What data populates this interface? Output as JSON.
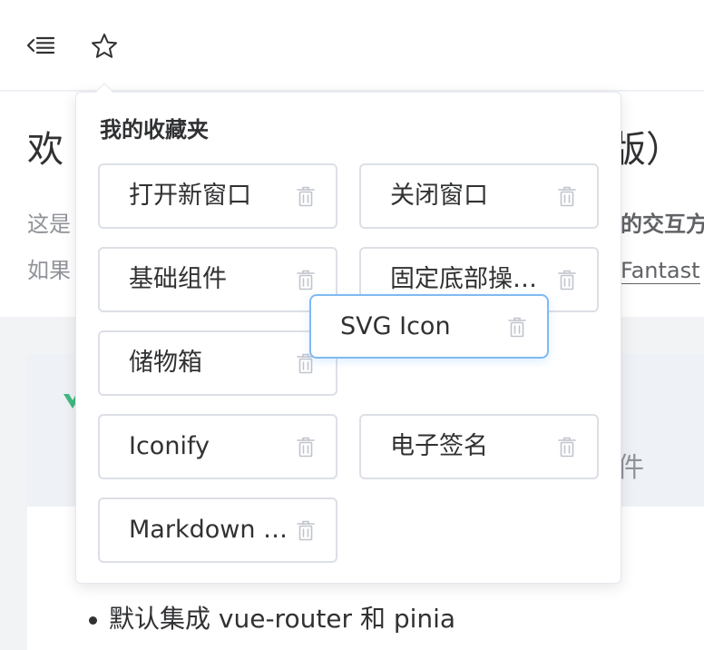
{
  "colors": {
    "accent": "#409eff",
    "drag_border": "#7fbaf2",
    "vue_green": "#42b883",
    "text_primary": "#303133",
    "text_secondary": "#909399"
  },
  "toolbar": {
    "collapse_icon": "collapse-menu-icon",
    "favorites_icon": "star-outline-icon"
  },
  "hero": {
    "title_left": "欢",
    "title_right": "业版）",
    "line1_left": "这是",
    "line1_right": "的交互方",
    "line2_left": "如果",
    "line2_link": "Fantast"
  },
  "content": {
    "band_glyph": "件",
    "bullets": [
      "默认集成 vue-router 和 pinia"
    ]
  },
  "favorites": {
    "title": "我的收藏夹",
    "trash_icon": "trash-icon",
    "items": [
      {
        "label": "打开新窗口"
      },
      {
        "label": "关闭窗口"
      },
      {
        "label": "基础组件"
      },
      {
        "label": "固定底部操作栏"
      },
      {
        "label": "储物箱"
      },
      {
        "label": "Iconify"
      },
      {
        "label": "电子签名"
      },
      {
        "label": "Markdown 编辑器"
      }
    ],
    "dragging": {
      "label": "SVG Icon"
    }
  }
}
